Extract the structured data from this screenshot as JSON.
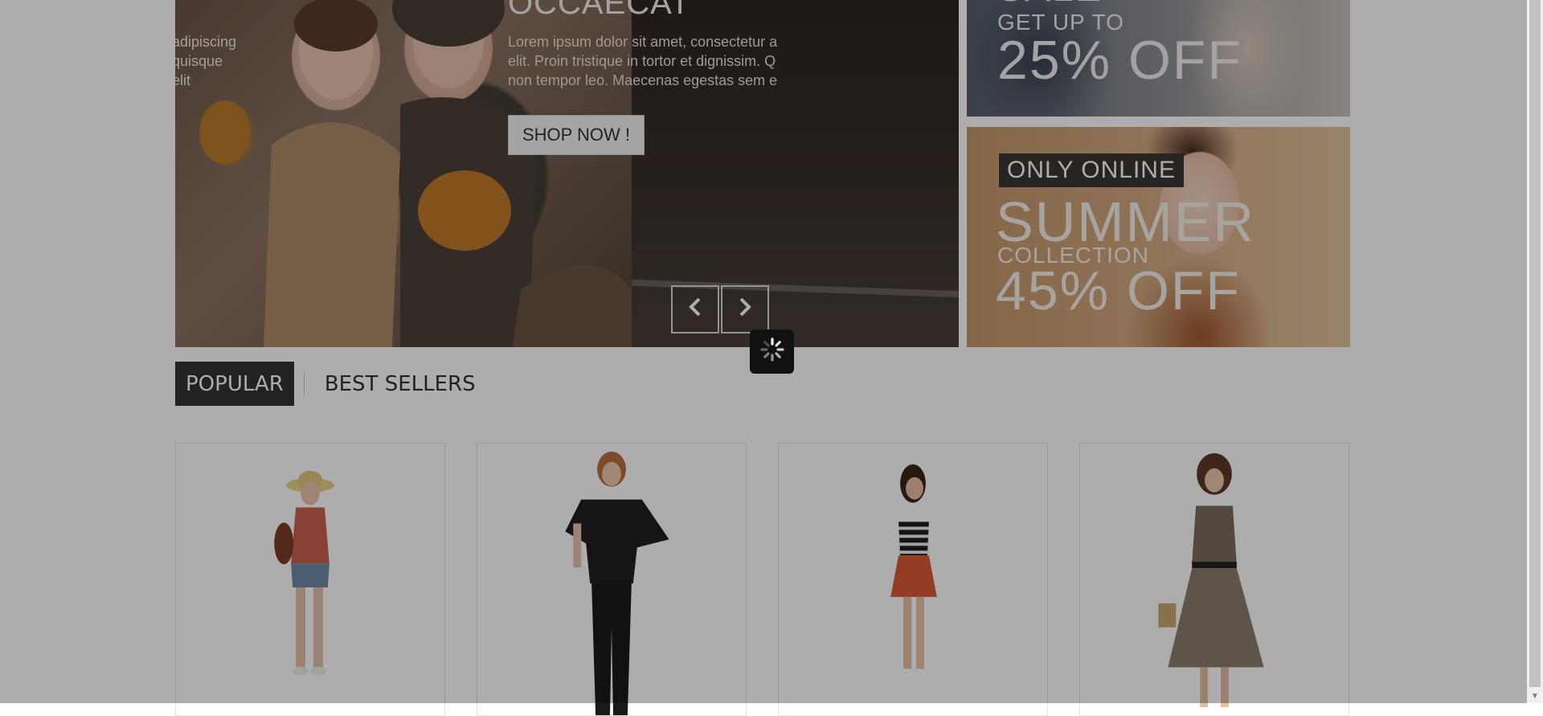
{
  "slider": {
    "left_text": [
      "adipiscing",
      "quisque",
      "elit"
    ],
    "title": "OCCAECAT",
    "text_lines": [
      "Lorem ipsum dolor sit amet, consectetur a",
      "elit. Proin tristique in tortor et dignissim. Q",
      "non tempor leo. Maecenas egestas sem e"
    ],
    "shop_button": "SHOP NOW !",
    "prev_icon": "chevron-left-icon",
    "next_icon": "chevron-right-icon"
  },
  "banner_top": {
    "sale": "SALE",
    "get_up_to": "GET UP TO",
    "off": "25% OFF"
  },
  "banner_bottom": {
    "only_online": "ONLY ONLINE",
    "summer": "SUMMER",
    "collection": "COLLECTION",
    "off": "45% OFF"
  },
  "tabs": {
    "popular": "POPULAR",
    "best_sellers": "BEST SELLERS"
  },
  "loader": {
    "icon": "spinner-icon"
  },
  "colors": {
    "overlay": "#000000",
    "tab_active_bg": "#333333"
  }
}
